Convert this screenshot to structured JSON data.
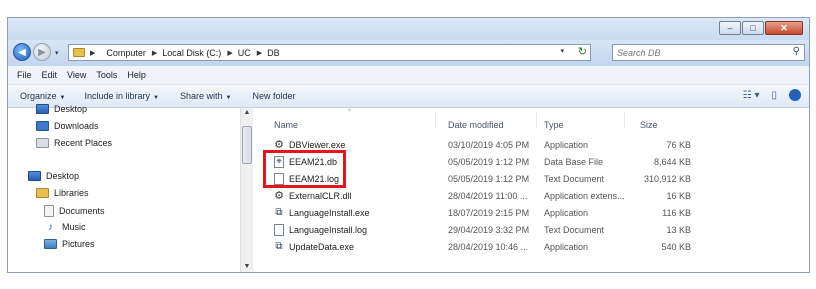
{
  "window": {
    "buttons": {
      "minimize": "–",
      "maximize": "□",
      "close": "✕"
    }
  },
  "address": {
    "crumbs": [
      "Computer",
      "Local Disk (C:)",
      "UC",
      "DB"
    ],
    "dropdown": "▾",
    "refresh": "↻"
  },
  "search": {
    "placeholder": "Search DB",
    "icon": "magnifier-icon"
  },
  "menubar": [
    "File",
    "Edit",
    "View",
    "Tools",
    "Help"
  ],
  "toolbar": {
    "organize": "Organize",
    "include": "Include in library",
    "share": "Share with",
    "new_folder": "New folder"
  },
  "navpane": {
    "favorites": [
      "Desktop",
      "Downloads",
      "Recent Places"
    ],
    "desktop": "Desktop",
    "libraries": "Libraries",
    "library_items": [
      "Documents",
      "Music",
      "Pictures"
    ]
  },
  "columns": {
    "name": "Name",
    "date": "Date modified",
    "type": "Type",
    "size": "Size"
  },
  "files": [
    {
      "name": "DBViewer.exe",
      "date": "03/10/2019 4:05 PM",
      "type": "Application",
      "size": "76 KB",
      "icon": "app-icon"
    },
    {
      "name": "EEAM21.db",
      "date": "05/05/2019 1:12 PM",
      "type": "Data Base File",
      "size": "8,644 KB",
      "icon": "database-file-icon"
    },
    {
      "name": "EEAM21.log",
      "date": "05/05/2019 1:12 PM",
      "type": "Text Document",
      "size": "310,912 KB",
      "icon": "text-file-icon"
    },
    {
      "name": "ExternalCLR.dll",
      "date": "28/04/2019 11:00 ...",
      "type": "Application extens...",
      "size": "16 KB",
      "icon": "dll-icon"
    },
    {
      "name": "LanguageInstall.exe",
      "date": "18/07/2019 2:15 PM",
      "type": "Application",
      "size": "116 KB",
      "icon": "exe-icon"
    },
    {
      "name": "LanguageInstall.log",
      "date": "29/04/2019 3:32 PM",
      "type": "Text Document",
      "size": "13 KB",
      "icon": "text-file-icon"
    },
    {
      "name": "UpdateData.exe",
      "date": "28/04/2019 10:46 ...",
      "type": "Application",
      "size": "540 KB",
      "icon": "exe-icon"
    }
  ],
  "highlight_color": "#e8131b"
}
